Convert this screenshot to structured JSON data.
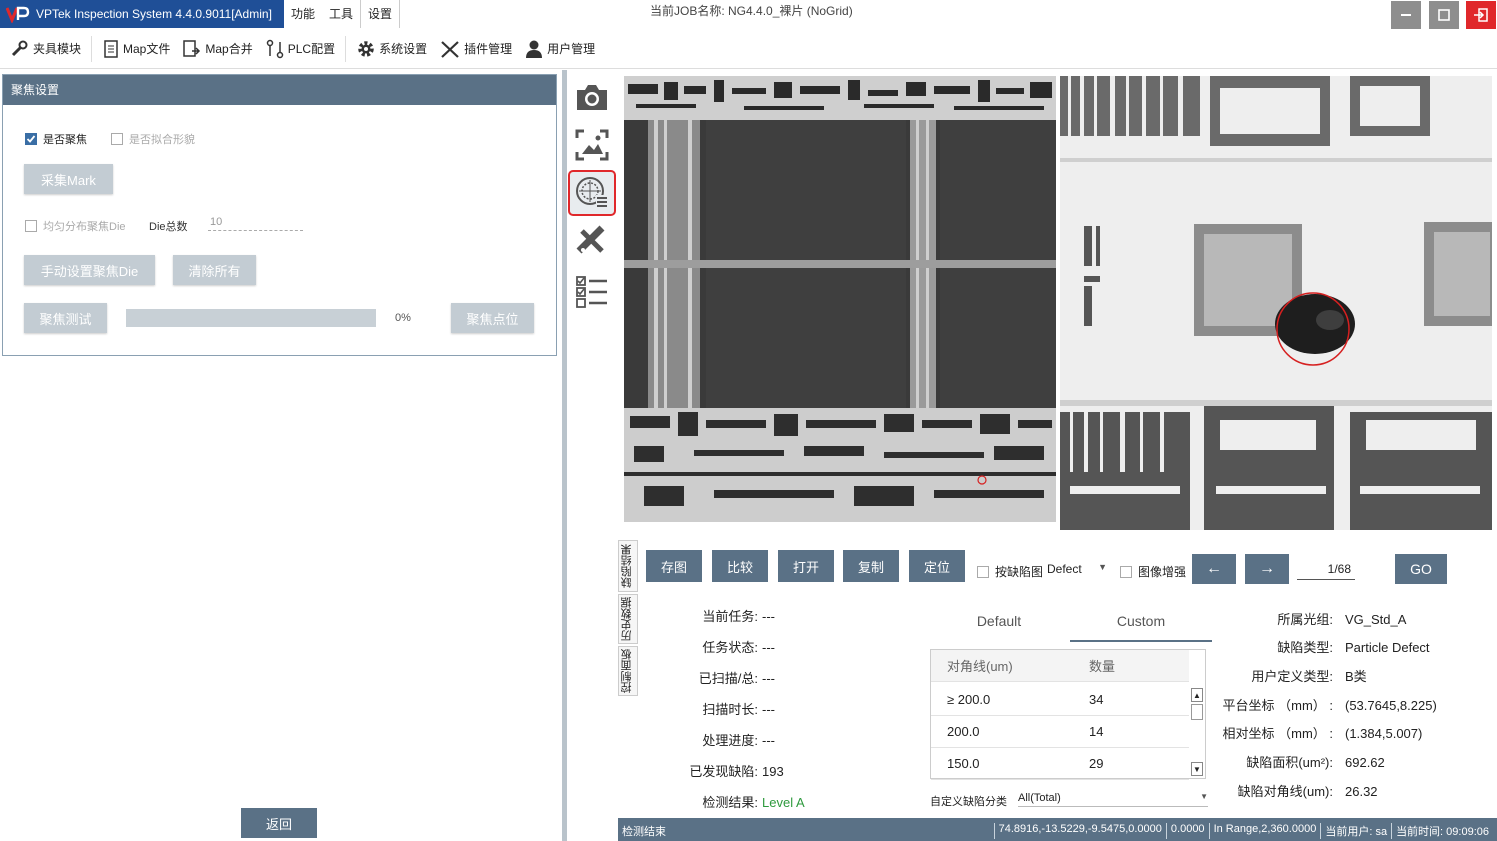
{
  "titlebar": {
    "app_title": "VPTek Inspection System 4.4.0.9011[Admin]",
    "menu": [
      "功能",
      "工具",
      "设置"
    ],
    "job": "当前JOB名称:  NG4.4.0_裸片 (NoGrid)"
  },
  "toolbar": {
    "items": [
      "夹具模块",
      "Map文件",
      "Map合并",
      "PLC配置",
      "系统设置",
      "插件管理",
      "用户管理"
    ]
  },
  "focus_panel": {
    "title": "聚焦设置",
    "chk_focus": "是否聚焦",
    "chk_fit": "是否拟合形貌",
    "btn_mark": "采集Mark",
    "chk_even": "均匀分布聚焦Die",
    "die_total_label": "Die总数",
    "die_total_value": "10",
    "btn_manual": "手动设置聚焦Die",
    "btn_clear": "清除所有",
    "btn_test": "聚焦测试",
    "progress_text": "0%",
    "progress_value": 0,
    "btn_point": "聚焦点位"
  },
  "back_label": "返回",
  "side_tabs": [
    "缺陷结果",
    "历史数据",
    "控制面板"
  ],
  "controls": {
    "save": "存图",
    "compare": "比较",
    "open": "打开",
    "copy": "复制",
    "locate": "定位",
    "chk_defect_map": "按缺陷图",
    "defect_select": "Defect",
    "chk_enhance": "图像增强",
    "prev": "←",
    "next": "→",
    "page": "1/68",
    "go": "GO"
  },
  "task_info": [
    {
      "label": "当前任务:",
      "value": "---"
    },
    {
      "label": "任务状态:",
      "value": "---"
    },
    {
      "label": "已扫描/总:",
      "value": "---"
    },
    {
      "label": "扫描时长:",
      "value": "---"
    },
    {
      "label": "处理进度:",
      "value": "---"
    },
    {
      "label": "已发现缺陷:",
      "value": "193"
    },
    {
      "label": "检测结果:",
      "value": "Level A"
    }
  ],
  "stats": {
    "tab_default": "Default",
    "tab_custom": "Custom",
    "col_diag": "对角线(um)",
    "col_count": "数量",
    "rows": [
      {
        "diag": "≥ 200.0",
        "count": "34"
      },
      {
        "diag": "200.0",
        "count": "14"
      },
      {
        "diag": "150.0",
        "count": "29"
      }
    ],
    "class_label": "自定义缺陷分类",
    "class_value": "All(Total)"
  },
  "defect_info": [
    {
      "label": "所属光组:",
      "value": "VG_Std_A"
    },
    {
      "label": "缺陷类型:",
      "value": "Particle Defect"
    },
    {
      "label": "用户定义类型:",
      "value": "B类"
    },
    {
      "label": "平台坐标 （mm） :",
      "value": "(53.7645,8.225)"
    },
    {
      "label": "相对坐标 （mm） :",
      "value": "(1.384,5.007)"
    },
    {
      "label": "缺陷面积(um²):",
      "value": "692.62"
    },
    {
      "label": "缺陷对角线(um):",
      "value": "26.32"
    }
  ],
  "statusbar": {
    "left": "检测结束",
    "segments": [
      "74.8916,-13.5229,-9.5475,0.0000",
      "0.0000",
      "In Range,2,360.0000",
      "当前用户:  sa",
      "当前时间:  09:09:06"
    ]
  },
  "colors": {
    "title_blue": "#1f4f97",
    "panel_slate": "#5a7186",
    "exit_red": "#e0282b",
    "result_green": "#2e9a3e"
  },
  "icons": [
    "camera-icon",
    "image-crop-icon",
    "focus-wafer-icon",
    "tools-icon",
    "checklist-icon"
  ]
}
